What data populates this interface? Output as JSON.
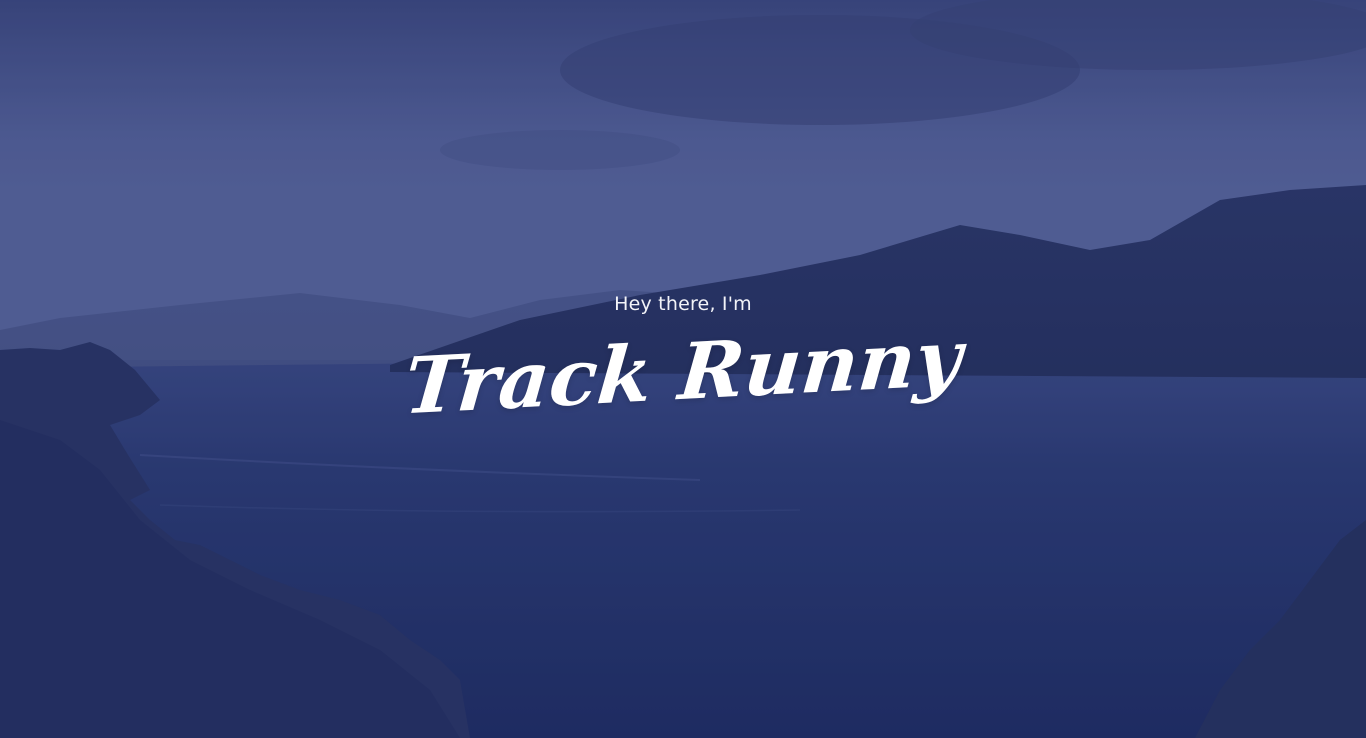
{
  "hero": {
    "greeting": "Hey there, I'm",
    "name": "Track Runny"
  },
  "colors": {
    "overlay": "#1c2660",
    "sky": "#56639a",
    "water": "#26356b",
    "text": "#ffffff"
  }
}
